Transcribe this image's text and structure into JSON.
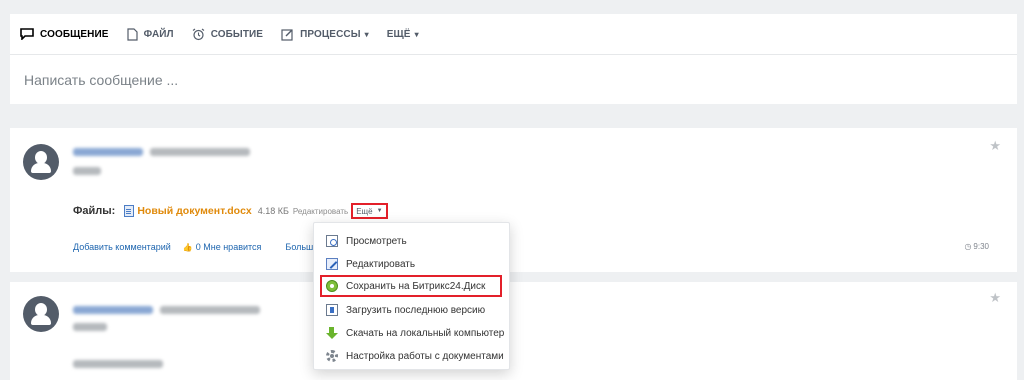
{
  "composer": {
    "tabs": [
      {
        "label": "СООБЩЕНИЕ",
        "icon": "message-icon",
        "active": true
      },
      {
        "label": "ФАЙЛ",
        "icon": "file-icon"
      },
      {
        "label": "СОБЫТИЕ",
        "icon": "alarm-clock-icon"
      },
      {
        "label": "ПРОЦЕССЫ",
        "icon": "edit-square-icon",
        "dropdown": true
      },
      {
        "label": "ЕЩЁ",
        "dropdown": true
      }
    ],
    "placeholder": "Написать сообщение ..."
  },
  "post1": {
    "files_label": "Файлы:",
    "file_name": "Новый документ.docx",
    "file_size": "4.18 КБ",
    "edit_label": "Редактировать",
    "more_label": "Ещё",
    "actions": {
      "comment": "Добавить комментарий",
      "dislike": "0 Мне нравится",
      "more": "Больше"
    },
    "time": "9:30"
  },
  "menu": {
    "items": [
      {
        "label": "Просмотреть",
        "icon": "view-icon"
      },
      {
        "label": "Редактировать",
        "icon": "edit-icon"
      },
      {
        "label": "Сохранить на Битрикс24.Диск",
        "icon": "disk-icon",
        "highlighted": true
      },
      {
        "label": "Загрузить последнюю версию",
        "icon": "upload-icon"
      },
      {
        "label": "Скачать на локальный компьютер",
        "icon": "download-icon"
      },
      {
        "label": "Настройка работы с документами",
        "icon": "gear-icon"
      }
    ]
  },
  "colors": {
    "accent_link": "#2067b0",
    "file_name": "#e08a0b",
    "highlight_border": "#e3202a",
    "background": "#eef0f2"
  }
}
